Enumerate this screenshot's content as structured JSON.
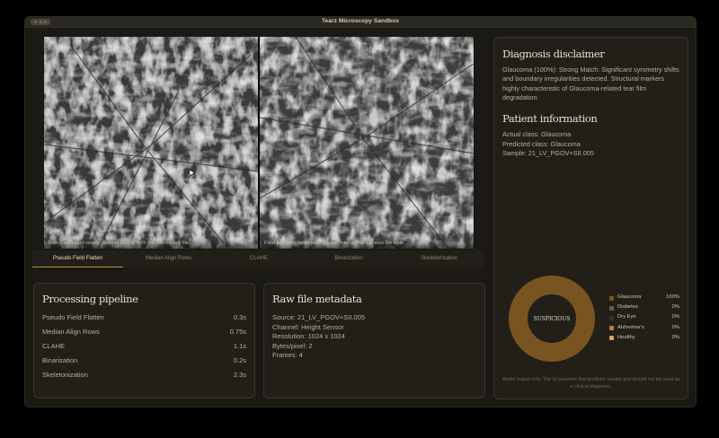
{
  "app": {
    "title": "Tearz Microscopy Sandbox"
  },
  "viewer": {
    "left_caption": "Raw Cao height-sensor channel loaded from the microscopy file.",
    "right_caption": "Field flattening helps remove slow intensity drift across the slide."
  },
  "tabs": [
    {
      "label": "Pseudo Field Flatten",
      "active": true
    },
    {
      "label": "Median Align Rows",
      "active": false
    },
    {
      "label": "CLAHE",
      "active": false
    },
    {
      "label": "Binarization",
      "active": false
    },
    {
      "label": "Skeletonization",
      "active": false
    }
  ],
  "pipeline": {
    "title": "Processing pipeline",
    "steps": [
      {
        "name": "Pseudo Field Flatten",
        "time": "0.3s"
      },
      {
        "name": "Median Align Rows",
        "time": "0.75s"
      },
      {
        "name": "CLAHE",
        "time": "1.1s"
      },
      {
        "name": "Binarization",
        "time": "0.2s"
      },
      {
        "name": "Skeletonization",
        "time": "2.3s"
      }
    ]
  },
  "metadata": {
    "title": "Raw file metadata",
    "lines": [
      "Source: 21_LV_PGOV+SII.005",
      "Channel: Height Sensor",
      "Resolution: 1024 x 1024",
      "Bytes/pixel: 2",
      "Frames: 4"
    ]
  },
  "diagnosis": {
    "title": "Diagnosis disclaimer",
    "text": "Glaucoma (100%): Strong Match: Significant symmetry shifts and boundary irregularities detected. Structural markers highly characteristic of Glaucoma-related tear film degradation."
  },
  "patient": {
    "title": "Patient information",
    "actual": "Actual class: Glaucoma",
    "predicted": "Predicted class: Glaucoma",
    "sample": "Sample: 21_LV_PGOV+SII.005"
  },
  "chart_data": {
    "type": "pie",
    "center_label": "SUSPICIOUS",
    "categories": [
      "Glaucoma",
      "Diabetes",
      "Dry Eye",
      "Alzheimer's",
      "Healthy"
    ],
    "values": [
      100,
      0,
      0,
      0,
      0
    ],
    "labels": [
      "100%",
      "0%",
      "0%",
      "0%",
      "0%"
    ],
    "colors": [
      "#7a5420",
      "#6f5a3a",
      "#3c3224",
      "#b87f4e",
      "#d8a56a"
    ],
    "legend_position": "right"
  },
  "footer": "Model output only. The UI presents live predictor results and should not be used as a clinical diagnosis."
}
